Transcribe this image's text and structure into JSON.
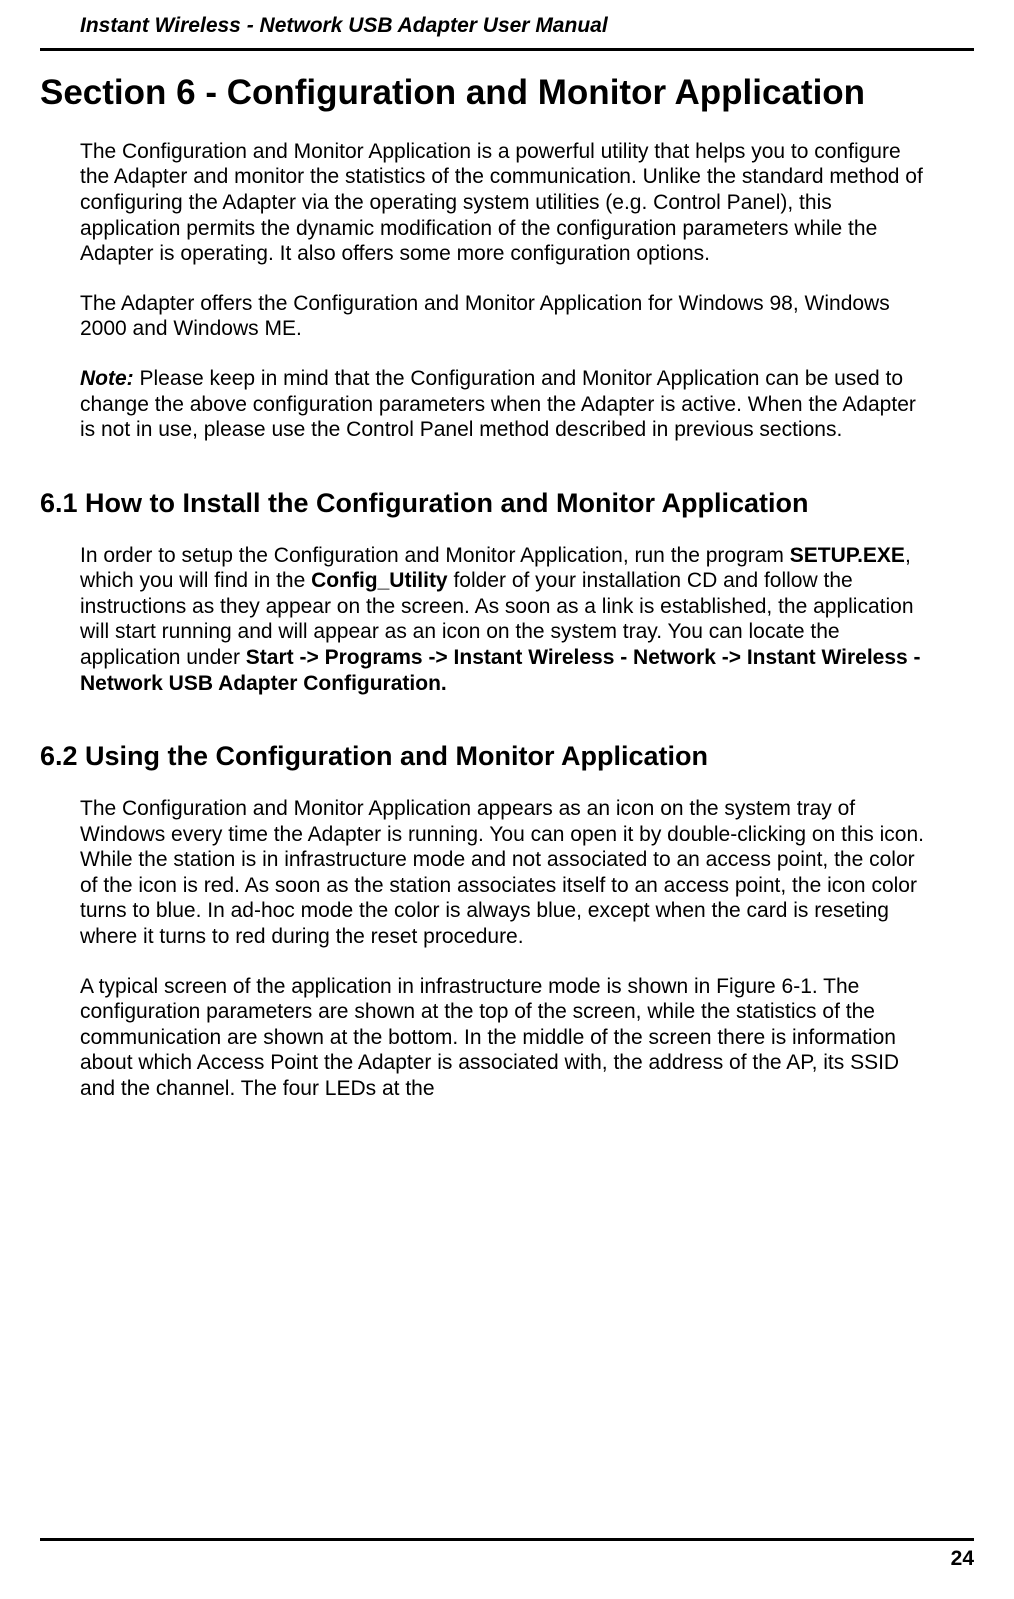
{
  "header": {
    "title": "Instant Wireless - Network USB Adapter User Manual"
  },
  "section_title": "Section 6 - Configuration and Monitor Application",
  "para1": "The Configuration and Monitor Application is a powerful utility that helps you to configure the Adapter and monitor the statistics of the communication. Unlike the standard method of configuring the Adapter via the operating system utilities (e.g. Control Panel), this application permits the dynamic modification of the configuration parameters while the Adapter is operating. It also offers some more configuration options.",
  "para2": "The Adapter offers the Configuration and Monitor Application for Windows 98, Windows 2000 and Windows ME.",
  "note_label": "Note:",
  "note_text": " Please keep in mind that the Configuration and Monitor Application can be used to change the above configuration parameters when the Adapter is active. When the Adapter is not in use, please use the Control Panel method described in previous sections.",
  "subsection_61_title": "6.1 How to Install the Configuration and Monitor Application",
  "sub61_text_a": "In order to setup the Configuration and Monitor Application, run the program ",
  "sub61_bold_a": "SETUP.EXE",
  "sub61_text_b": ", which you will find in the ",
  "sub61_bold_b": "Config_Utility",
  "sub61_text_c": " folder of your installation CD and follow the instructions as they appear on the screen. As soon as a link is established, the application will start running and will appear as an icon on the system tray. You can locate the application under ",
  "sub61_bold_c": "Start -> Programs -> Instant Wireless - Network -> Instant Wireless - Network USB Adapter Configuration.",
  "subsection_62_title": "6.2 Using the Configuration and Monitor Application",
  "sub62_para1": "The Configuration and Monitor Application appears as an icon on the system tray of Windows every time the Adapter is running. You can open it by double-clicking on this icon. While the station is in infrastructure mode and not associated to an access point, the color of the icon is red. As soon as the station associates itself to an access point, the icon color turns to blue. In ad-hoc mode the color is always blue, except when the card is reseting where it turns to red during the reset procedure.",
  "sub62_para2": "A typical screen of the application in infrastructure mode is shown in Figure 6-1. The configuration parameters are shown at the top of the screen, while the statistics of the communication are shown at the bottom. In the middle of the screen there is information about which Access Point the Adapter is associated with, the address of the AP, its SSID and the channel. The four LEDs at the",
  "page_number": "24"
}
